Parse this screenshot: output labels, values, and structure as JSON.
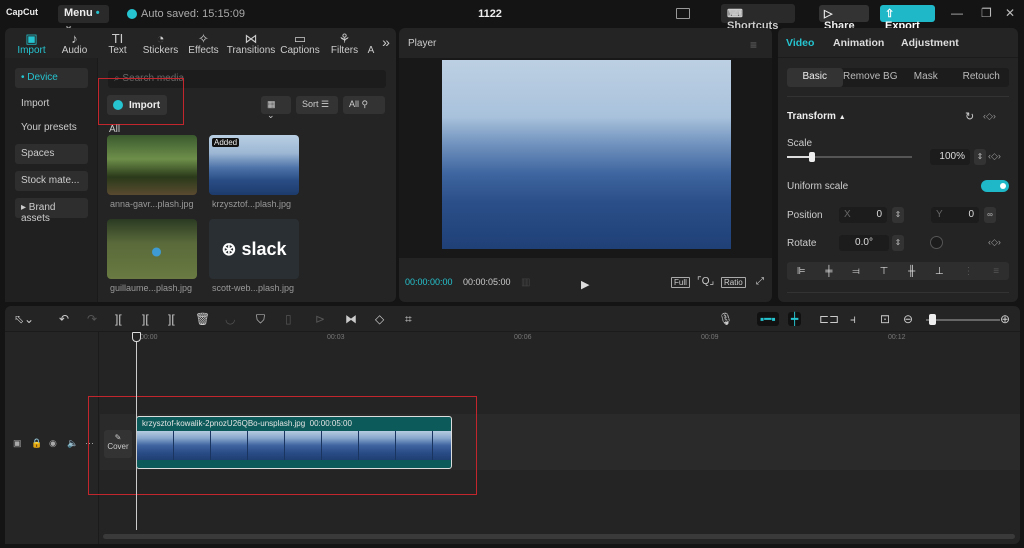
{
  "app": {
    "logo": "CapCut",
    "menu_label": "Menu",
    "autosave": "Auto saved: 15:15:09",
    "project_title": "1122",
    "shortcuts_label": "Shortcuts",
    "share_label": "Share",
    "export_label": "Export",
    "accent_color": "#25c4d0"
  },
  "left_tabs": [
    {
      "label": "Import",
      "icon": "import-icon"
    },
    {
      "label": "Audio",
      "icon": "audio-icon"
    },
    {
      "label": "Text",
      "icon": "text-icon"
    },
    {
      "label": "Stickers",
      "icon": "stickers-icon"
    },
    {
      "label": "Effects",
      "icon": "effects-icon"
    },
    {
      "label": "Transitions",
      "icon": "transitions-icon"
    },
    {
      "label": "Captions",
      "icon": "captions-icon"
    },
    {
      "label": "Filters",
      "icon": "filters-icon"
    },
    {
      "label": "A",
      "icon": ""
    }
  ],
  "sidebar": {
    "items": [
      "• Device",
      "Import",
      "Your presets",
      "Spaces",
      "Stock mate...",
      "▸ Brand assets"
    ]
  },
  "media": {
    "search_placeholder": "Search media",
    "import_label": "Import",
    "sort_label": "Sort",
    "filter_label": "All",
    "section_label": "All",
    "items": [
      {
        "name": "anna-gavr...plash.jpg",
        "added": ""
      },
      {
        "name": "krzysztof...plash.jpg",
        "added": "Added"
      },
      {
        "name": "guillaume...plash.jpg",
        "added": ""
      },
      {
        "name": "scott-web...plash.jpg",
        "added": "",
        "logo_text": "slack"
      }
    ]
  },
  "player": {
    "title": "Player",
    "current_time": "00:00:00:00",
    "duration": "00:00:05:00",
    "full_label": "Full",
    "ratio_label": "Ratio"
  },
  "inspector": {
    "tabs": [
      "Video",
      "Animation",
      "Adjustment"
    ],
    "subtabs": [
      "Basic",
      "Remove BG",
      "Mask",
      "Retouch"
    ],
    "section": "Transform",
    "scale_label": "Scale",
    "scale_value": "100%",
    "scale_fraction": 0.2,
    "uniform_scale_label": "Uniform scale",
    "uniform_scale_on": true,
    "position_label": "Position",
    "x_label": "X",
    "x_value": "0",
    "y_label": "Y",
    "y_value": "0",
    "rotate_label": "Rotate",
    "rotate_value": "0.0°"
  },
  "timeline": {
    "ruler": [
      "00:00",
      "00:03",
      "00:06",
      "00:09",
      "00:12"
    ],
    "clip_name": "krzysztof-kowalik-2pnozU26QBo-unsplash.jpg",
    "clip_duration": "00:00:05:00",
    "cover_label": "Cover",
    "zoom_fraction": 0.08
  }
}
